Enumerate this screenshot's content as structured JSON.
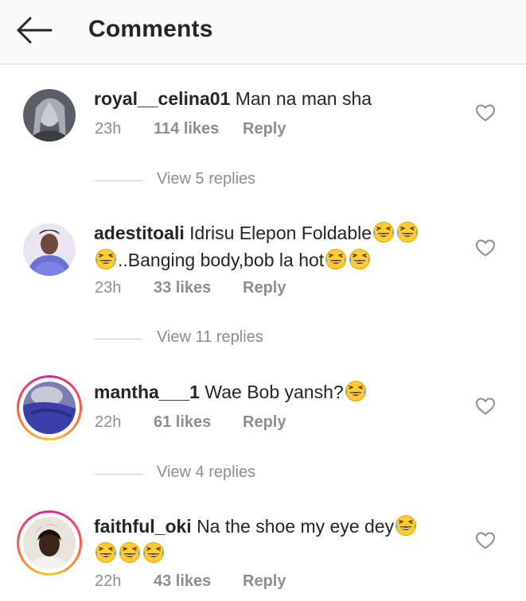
{
  "header": {
    "title": "Comments",
    "back_icon": "arrow-left-icon"
  },
  "colors": {
    "text": "#262626",
    "secondary": "#8e8e8e",
    "divider": "#dbdbdb",
    "story_ring": [
      "#d6249f",
      "#fd5949",
      "#fdc830"
    ]
  },
  "comments": [
    {
      "username": "royal__celina01",
      "text_line1": "Man na man sha",
      "text_line2": "",
      "time": "23h",
      "likes": "114 likes",
      "reply": "Reply",
      "view_replies": "View 5 replies",
      "has_story_ring": false
    },
    {
      "username": "adestitoali",
      "text_line1": "Idrisu Elepon Foldable",
      "text_line2": "..Banging body,bob la hot",
      "time": "23h",
      "likes": "33 likes",
      "reply": "Reply",
      "view_replies": "View 11 replies",
      "has_story_ring": false
    },
    {
      "username": "mantha___1",
      "text_line1": "Wae Bob yansh?",
      "text_line2": "",
      "time": "22h",
      "likes": "61 likes",
      "reply": "Reply",
      "view_replies": "View 4 replies",
      "has_story_ring": true
    },
    {
      "username": "faithful_oki",
      "text_line1": "Na the shoe my eye dey",
      "text_line2": "",
      "time": "22h",
      "likes": "43 likes",
      "reply": "Reply",
      "view_replies": "",
      "has_story_ring": true
    }
  ]
}
